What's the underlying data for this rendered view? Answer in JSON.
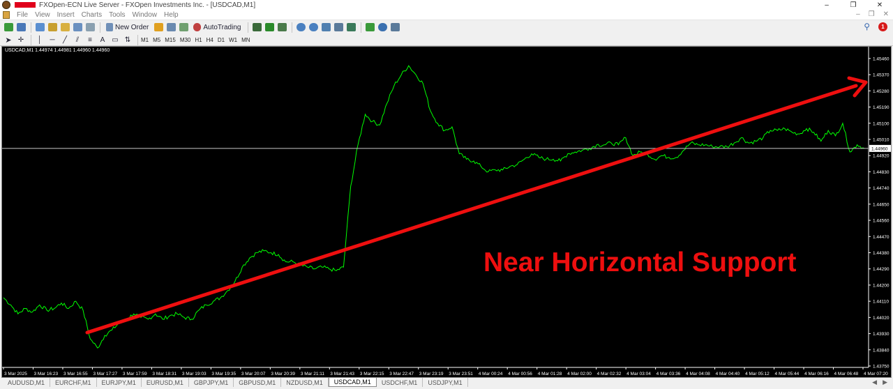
{
  "window": {
    "title": "FXOpen-ECN Live Server - FXOpen Investments Inc. - [USDCAD,M1]",
    "controls": [
      "–",
      "❐",
      "✕"
    ]
  },
  "menu": {
    "items": [
      "File",
      "View",
      "Insert",
      "Charts",
      "Tools",
      "Window",
      "Help"
    ],
    "right_controls": [
      "–",
      "❐",
      "✕"
    ]
  },
  "toolbar": {
    "new_order_label": "New Order",
    "autotrading_label": "AutoTrading",
    "notification_count": "1",
    "timeframes": [
      "M1",
      "M5",
      "M15",
      "M30",
      "H1",
      "H4",
      "D1",
      "W1",
      "MN"
    ]
  },
  "chart": {
    "header": "USDCAD,M1  1.44974 1.44981 1.44960 1.44960",
    "current_price": "1.44960",
    "annotation": "Near Horizontal Support",
    "colors": {
      "background": "#000000",
      "price_line": "#00ff00",
      "trendline": "#ee0f0f",
      "annotation_text": "#ee0f0f",
      "axis_text": "#ffffff"
    }
  },
  "chart_data": {
    "type": "line",
    "title": "USDCAD,M1",
    "y_ticks": [
      "1.45460",
      "1.45370",
      "1.45280",
      "1.45190",
      "1.45100",
      "1.45010",
      "1.44920",
      "1.44830",
      "1.44740",
      "1.44650",
      "1.44560",
      "1.44470",
      "1.44380",
      "1.44290",
      "1.44200",
      "1.44110",
      "1.44020",
      "1.43930",
      "1.43840",
      "1.43750"
    ],
    "x_ticks": [
      "3 Mar 2025",
      "3 Mar 16:23",
      "3 Mar 16:55",
      "3 Mar 17:27",
      "3 Mar 17:59",
      "3 Mar 18:31",
      "3 Mar 19:03",
      "3 Mar 19:35",
      "3 Mar 20:07",
      "3 Mar 20:39",
      "3 Mar 21:11",
      "3 Mar 21:43",
      "3 Mar 22:15",
      "3 Mar 22:47",
      "3 Mar 23:19",
      "3 Mar 23:51",
      "4 Mar 00:24",
      "4 Mar 00:56",
      "4 Mar 01:28",
      "4 Mar 02:00",
      "4 Mar 02:32",
      "4 Mar 03:04",
      "4 Mar 03:36",
      "4 Mar 04:08",
      "4 Mar 04:40",
      "4 Mar 05:12",
      "4 Mar 05:44",
      "4 Mar 06:16",
      "4 Mar 06:48",
      "4 Mar 07:20"
    ],
    "ylim": [
      1.4375,
      1.4551
    ],
    "series": [
      {
        "values": [
          1.4413,
          1.4409,
          1.4404,
          1.4407,
          1.4405,
          1.4409,
          1.4406,
          1.4407,
          1.441,
          1.4407,
          1.4411,
          1.4406,
          1.439,
          1.4385,
          1.4392,
          1.4395,
          1.4399,
          1.4401,
          1.4404,
          1.4402,
          1.4401,
          1.4404,
          1.4401,
          1.4403,
          1.4404,
          1.4402,
          1.4401,
          1.4406,
          1.4409,
          1.4411,
          1.4413,
          1.4417,
          1.4422,
          1.443,
          1.4435,
          1.4438,
          1.4439,
          1.4438,
          1.4437,
          1.4433,
          1.4433,
          1.4431,
          1.443,
          1.4429,
          1.443,
          1.4429,
          1.4428,
          1.443,
          1.4475,
          1.4498,
          1.4515,
          1.4511,
          1.4509,
          1.4521,
          1.4531,
          1.4537,
          1.4542,
          1.4537,
          1.4532,
          1.4517,
          1.451,
          1.4506,
          1.4508,
          1.4493,
          1.449,
          1.4489,
          1.4486,
          1.4483,
          1.4484,
          1.4484,
          1.4486,
          1.4487,
          1.449,
          1.4493,
          1.4491,
          1.449,
          1.449,
          1.4489,
          1.4493,
          1.4494,
          1.4495,
          1.4496,
          1.4498,
          1.4498,
          1.4499,
          1.4498,
          1.4502,
          1.4492,
          1.4494,
          1.4493,
          1.449,
          1.4492,
          1.4491,
          1.4491,
          1.4495,
          1.4499,
          1.4498,
          1.4498,
          1.4497,
          1.4497,
          1.4497,
          1.4499,
          1.4502,
          1.4499,
          1.45,
          1.4502,
          1.4506,
          1.4506,
          1.4507,
          1.4505,
          1.4504,
          1.4507,
          1.4505,
          1.45,
          1.4506,
          1.4503,
          1.451,
          1.4494,
          1.4498,
          1.4496
        ]
      }
    ]
  }
}
